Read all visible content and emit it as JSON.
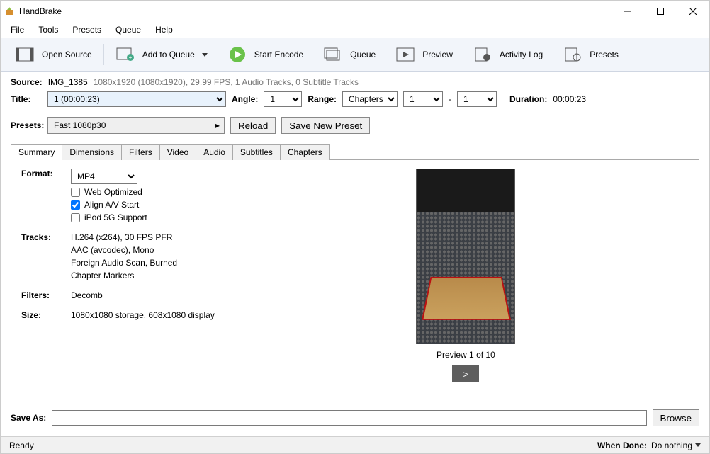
{
  "app": {
    "title": "HandBrake"
  },
  "menus": [
    "File",
    "Tools",
    "Presets",
    "Queue",
    "Help"
  ],
  "toolbar": {
    "open_source": "Open Source",
    "add_to_queue": "Add to Queue",
    "start_encode": "Start Encode",
    "queue": "Queue",
    "preview": "Preview",
    "activity_log": "Activity Log",
    "presets": "Presets"
  },
  "source": {
    "label": "Source:",
    "value": "IMG_1385",
    "details": "1080x1920 (1080x1920), 29.99 FPS, 1 Audio Tracks, 0 Subtitle Tracks"
  },
  "title": {
    "label": "Title:",
    "value": "1 (00:00:23)",
    "angle_label": "Angle:",
    "angle_value": "1",
    "range_label": "Range:",
    "range_type": "Chapters",
    "range_start": "1",
    "range_sep": "-",
    "range_end": "1",
    "duration_label": "Duration:",
    "duration_value": "00:00:23"
  },
  "presets": {
    "label": "Presets:",
    "value": "Fast 1080p30",
    "reload": "Reload",
    "save_new": "Save New Preset"
  },
  "tabs": [
    "Summary",
    "Dimensions",
    "Filters",
    "Video",
    "Audio",
    "Subtitles",
    "Chapters"
  ],
  "summary": {
    "format_label": "Format:",
    "format_value": "MP4",
    "web_optimized": "Web Optimized",
    "align_av": "Align A/V Start",
    "ipod": "iPod 5G Support",
    "tracks_label": "Tracks:",
    "tracks_lines": [
      "H.264 (x264), 30 FPS PFR",
      "AAC (avcodec), Mono",
      "Foreign Audio Scan, Burned",
      "Chapter Markers"
    ],
    "filters_label": "Filters:",
    "filters_value": "Decomb",
    "size_label": "Size:",
    "size_value": "1080x1080 storage, 608x1080 display",
    "preview_label": "Preview 1 of 10",
    "preview_next": ">"
  },
  "save": {
    "label": "Save As:",
    "value": "",
    "browse": "Browse"
  },
  "status": {
    "left": "Ready",
    "done_label": "When Done:",
    "done_value": "Do nothing"
  }
}
